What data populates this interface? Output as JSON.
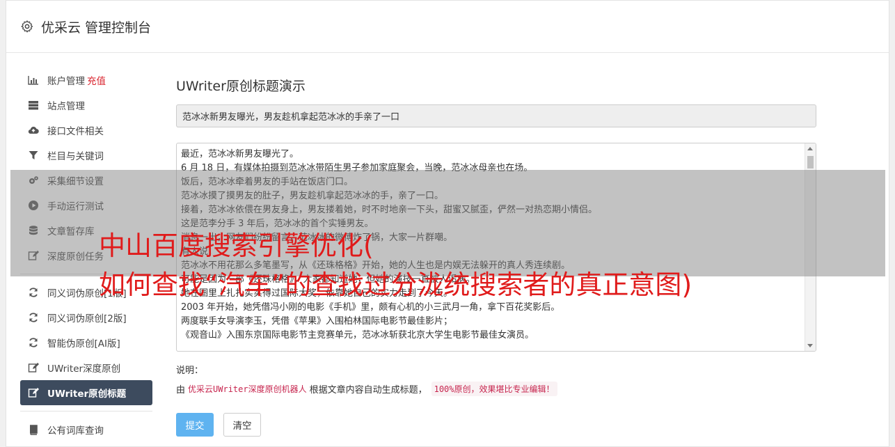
{
  "header": {
    "title": "优采云 管理控制台",
    "icon": "gear-icon"
  },
  "sidebar": {
    "group1": [
      {
        "label": "账户管理",
        "extra": "充值",
        "icon": "bar-chart-icon"
      },
      {
        "label": "站点管理",
        "icon": "server-icon"
      },
      {
        "label": "接口文件相关",
        "icon": "cloud-upload-icon"
      },
      {
        "label": "栏目与关键词",
        "icon": "filter-icon"
      },
      {
        "label": "采集细节设置",
        "icon": "gears-icon"
      },
      {
        "label": "手动运行测试",
        "icon": "play-circle-icon"
      },
      {
        "label": "文章暂存库",
        "icon": "database-icon"
      },
      {
        "label": "深度原创任务",
        "icon": "edit-icon"
      }
    ],
    "group2": [
      {
        "label": "同义词伪原创[1版]",
        "icon": "refresh-icon"
      },
      {
        "label": "同义词伪原创[2版]",
        "icon": "refresh-icon"
      },
      {
        "label": "智能伪原创[AI版]",
        "icon": "refresh-icon"
      },
      {
        "label": "UWriter深度原创",
        "icon": "edit-icon"
      },
      {
        "label": "UWriter原创标题",
        "icon": "edit-icon",
        "active": true
      }
    ],
    "group3": [
      {
        "label": "公有词库查询",
        "icon": "book-icon"
      }
    ]
  },
  "main": {
    "heading": "UWriter原创标题演示",
    "title_value": "范冰冰新男友曝光，男友趁机拿起范冰冰的手亲了一口",
    "article_lines": [
      "最近，范冰冰新男友曝光了。",
      "6 月 18 日，有媒体拍摄到范冰冰带陌生男子参加家庭聚会，当晚，范冰冰母亲也在场。",
      "饭后，范冰冰牵着男友的手站在饭店门口。",
      "范冰冰摸了摸男友的肚子，男友趁机拿起范冰冰的手，亲了一口。",
      "接着，范冰冰依偎在男友身上，男友搂着她，时不时地亲一下头，甜蜜又腻歪，俨然一对热恋期小情侣。",
      "这是范李分手 3 年后，范冰冰的首个实锤男友。",
      "消息一出，网友们纷纷留言，范冰冰的微博炸了锅，大家一片群嘲。",
      "有人说：",
      "范冰冰不用花那么多笔墨写，从《还珠格格》开始，她的人生也是内娱无法躲开的真人秀连续剧。",
      "可能是因为一部《还珠格格》，大家都知道她，但她的演技一直被人诟病。",
      "她在圈里上扎扎实实得过国际大奖，依靠她自己的实力走到了今天。",
      "2003 年开始，她凭借冯小刚的电影《手机》里，颇有心机的小三武月一角，拿下百花奖影后。",
      "两度联手女导演李玉，凭借《苹果》入围柏林国际电影节最佳影片；",
      "《观音山》入围东京国际电影节主竞赛单元，范冰冰斩获北京大学生电影节最佳女演员。"
    ],
    "note_label": "说明：",
    "note_prefix": "由",
    "note_link": "优采云UWriter深度原创机器人",
    "note_middle": "根据文章内容自动生成标题，",
    "note_badge": "100%原创，效果堪比专业编辑！",
    "submit_label": "提交",
    "clear_label": "清空"
  },
  "overlay": {
    "line1": "中山百度搜索引擎优化(",
    "line2": "如何查找“汽车”的查找过分泷统搜索者的真正意图)"
  },
  "colors": {
    "accent": "#5fb3f0",
    "active_bg": "#3d4b5e",
    "overlay_text": "#e01b1b",
    "recharge": "#d9232d"
  }
}
